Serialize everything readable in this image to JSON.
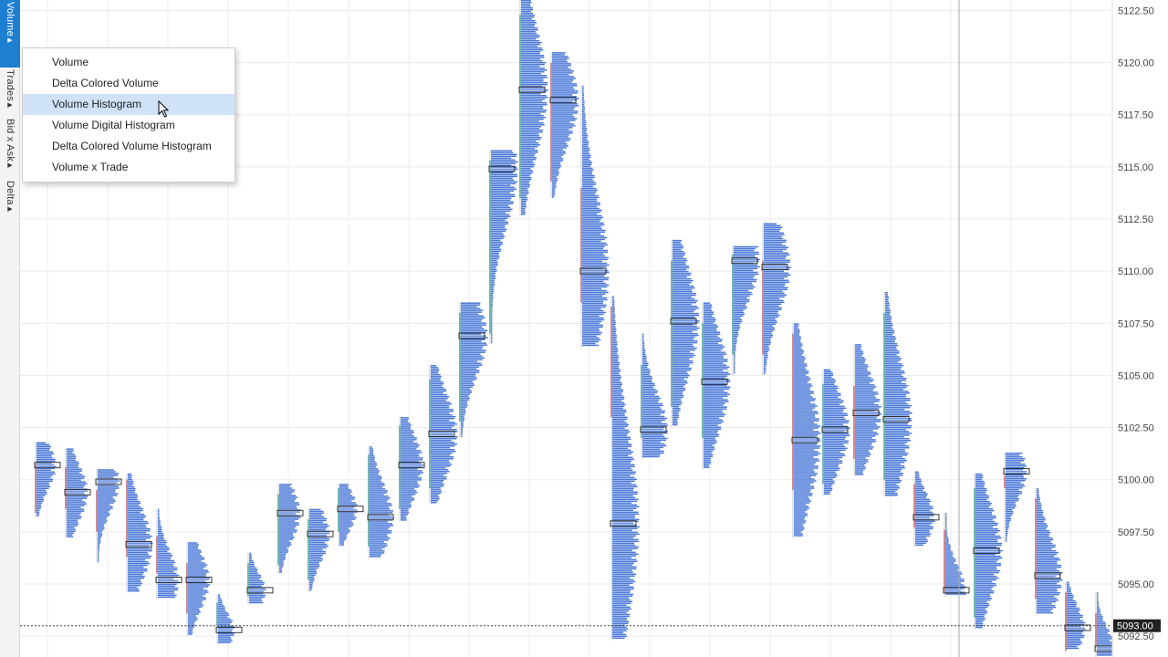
{
  "side_tabs": [
    {
      "label": "Volume",
      "active": true
    },
    {
      "label": "Trades",
      "active": false
    },
    {
      "label": "Bid x Ask",
      "active": false
    },
    {
      "label": "Delta",
      "active": false
    }
  ],
  "menu": {
    "items": [
      {
        "label": "Volume",
        "selected": false
      },
      {
        "label": "Delta Colored Volume",
        "selected": false
      },
      {
        "label": "Volume Histogram",
        "selected": true
      },
      {
        "label": "Volume Digital Histogram",
        "selected": false
      },
      {
        "label": "Delta Colored Volume Histogram",
        "selected": false
      },
      {
        "label": "Volume x Trade",
        "selected": false
      }
    ]
  },
  "colors": {
    "histogram": "#4a78d8",
    "candle_up": "#5cb8b2",
    "candle_down": "#e07a85",
    "grid": "#ececec",
    "accent": "#1e7fd1",
    "price_tag_bg": "#222222"
  },
  "chart_data": {
    "type": "candlestick-volume-profile",
    "y_ticks": [
      "5122.50",
      "5120.00",
      "5117.50",
      "5115.00",
      "5112.50",
      "5110.00",
      "5107.50",
      "5105.00",
      "5102.50",
      "5100.00",
      "5097.50",
      "5095.00",
      "5092.50"
    ],
    "ylim": [
      5091.5,
      5123.0
    ],
    "current_price": "5093.00",
    "grid": true,
    "bars": [
      {
        "low": 5098.2,
        "high": 5101.8,
        "open": 5100.8,
        "close": 5098.4,
        "poc": 5100.7
      },
      {
        "low": 5097.2,
        "high": 5101.5,
        "open": 5100.6,
        "close": 5098.6,
        "poc": 5099.4
      },
      {
        "low": 5096.0,
        "high": 5100.5,
        "open": 5099.5,
        "close": 5097.5,
        "poc": 5099.9
      },
      {
        "low": 5094.6,
        "high": 5100.3,
        "open": 5100.0,
        "close": 5096.3,
        "poc": 5096.9
      },
      {
        "low": 5094.3,
        "high": 5098.6,
        "open": 5097.3,
        "close": 5095.5,
        "poc": 5095.2
      },
      {
        "low": 5092.5,
        "high": 5097.0,
        "open": 5096.0,
        "close": 5093.6,
        "poc": 5095.2
      },
      {
        "low": 5092.1,
        "high": 5094.5,
        "open": 5093.0,
        "close": 5094.1,
        "poc": 5092.8
      },
      {
        "low": 5094.0,
        "high": 5096.5,
        "open": 5094.4,
        "close": 5096.0,
        "poc": 5094.7
      },
      {
        "low": 5095.5,
        "high": 5099.8,
        "open": 5095.9,
        "close": 5099.3,
        "poc": 5098.4
      },
      {
        "low": 5094.6,
        "high": 5098.6,
        "open": 5095.2,
        "close": 5098.1,
        "poc": 5097.4
      },
      {
        "low": 5096.8,
        "high": 5099.8,
        "open": 5097.5,
        "close": 5099.6,
        "poc": 5098.6
      },
      {
        "low": 5096.2,
        "high": 5101.6,
        "open": 5096.8,
        "close": 5101.2,
        "poc": 5098.2
      },
      {
        "low": 5098.0,
        "high": 5103.0,
        "open": 5098.6,
        "close": 5102.6,
        "poc": 5100.7
      },
      {
        "low": 5098.8,
        "high": 5105.5,
        "open": 5099.6,
        "close": 5104.8,
        "poc": 5102.2
      },
      {
        "low": 5102.0,
        "high": 5108.5,
        "open": 5102.8,
        "close": 5108.0,
        "poc": 5106.9
      },
      {
        "low": 5106.5,
        "high": 5115.8,
        "open": 5107.0,
        "close": 5115.3,
        "poc": 5114.9
      },
      {
        "low": 5112.6,
        "high": 5123.0,
        "open": 5113.5,
        "close": 5122.3,
        "poc": 5118.7
      },
      {
        "low": 5113.5,
        "high": 5120.5,
        "open": 5120.0,
        "close": 5114.3,
        "poc": 5118.2
      },
      {
        "low": 5106.3,
        "high": 5118.9,
        "open": 5114.0,
        "close": 5108.5,
        "poc": 5110.0
      },
      {
        "low": 5092.3,
        "high": 5108.8,
        "open": 5108.3,
        "close": 5103.0,
        "poc": 5097.9
      },
      {
        "low": 5101.0,
        "high": 5107.0,
        "open": 5102.0,
        "close": 5105.5,
        "poc": 5102.4
      },
      {
        "low": 5102.5,
        "high": 5111.5,
        "open": 5103.5,
        "close": 5110.5,
        "poc": 5107.6
      },
      {
        "low": 5100.5,
        "high": 5108.5,
        "open": 5102.0,
        "close": 5107.5,
        "poc": 5104.7
      },
      {
        "low": 5105.0,
        "high": 5111.2,
        "open": 5106.0,
        "close": 5110.8,
        "poc": 5110.5
      },
      {
        "low": 5105.0,
        "high": 5112.3,
        "open": 5110.5,
        "close": 5106.0,
        "poc": 5110.2
      },
      {
        "low": 5097.2,
        "high": 5107.5,
        "open": 5107.0,
        "close": 5099.5,
        "poc": 5101.9
      },
      {
        "low": 5099.2,
        "high": 5105.3,
        "open": 5099.8,
        "close": 5104.6,
        "poc": 5102.4
      },
      {
        "low": 5100.2,
        "high": 5106.5,
        "open": 5104.5,
        "close": 5101.0,
        "poc": 5103.2
      },
      {
        "low": 5099.2,
        "high": 5109.0,
        "open": 5100.0,
        "close": 5108.0,
        "poc": 5102.9
      },
      {
        "low": 5096.8,
        "high": 5100.4,
        "open": 5099.8,
        "close": 5097.7,
        "poc": 5098.2
      },
      {
        "low": 5094.4,
        "high": 5098.4,
        "open": 5097.6,
        "close": 5094.6,
        "poc": 5094.7
      },
      {
        "low": 5092.8,
        "high": 5100.3,
        "open": 5093.4,
        "close": 5099.6,
        "poc": 5096.6
      },
      {
        "low": 5097.0,
        "high": 5101.3,
        "open": 5100.2,
        "close": 5099.6,
        "poc": 5100.4
      },
      {
        "low": 5093.5,
        "high": 5099.6,
        "open": 5099.1,
        "close": 5094.3,
        "poc": 5095.4
      },
      {
        "low": 5091.8,
        "high": 5095.1,
        "open": 5094.6,
        "close": 5091.8,
        "poc": 5092.9
      },
      {
        "low": 5091.5,
        "high": 5094.6,
        "open": 5093.6,
        "close": 5092.0,
        "poc": 5091.9
      }
    ]
  }
}
